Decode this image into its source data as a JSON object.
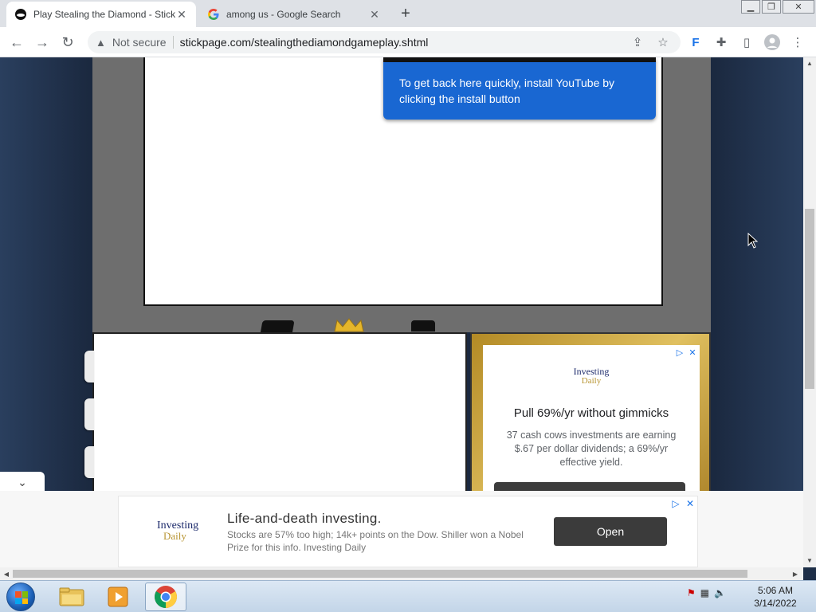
{
  "browser": {
    "tabs": [
      {
        "title": "Play Stealing the Diamond - Stick",
        "active": true
      },
      {
        "title": "among us - Google Search",
        "active": false
      }
    ],
    "security_label": "Not secure",
    "url": "stickpage.com/stealingthediamondgameplay.shtml"
  },
  "page": {
    "install_tip": "To get back here quickly, install YouTube by clicking the install button",
    "side_ad": {
      "logo_top": "Investing",
      "logo_bottom": "Daily",
      "headline": "Pull 69%/yr without gimmicks",
      "body": "37 cash cows investments are earning $.67 per dollar dividends; a 69%/yr effective yield."
    },
    "anchor_ad": {
      "logo_top": "Investing",
      "logo_bottom": "Daily",
      "headline": "Life-and-death investing.",
      "body": "Stocks are 57% too high; 14k+ points on the Dow. Shiller won a Nobel Prize for this info. Investing Daily",
      "cta": "Open"
    }
  },
  "taskbar": {
    "time": "5:06 AM",
    "date": "3/14/2022"
  },
  "colors": {
    "tooltip_blue": "#1967d2",
    "page_bg": "#1b2940",
    "game_frame": "#6e6e6e"
  }
}
